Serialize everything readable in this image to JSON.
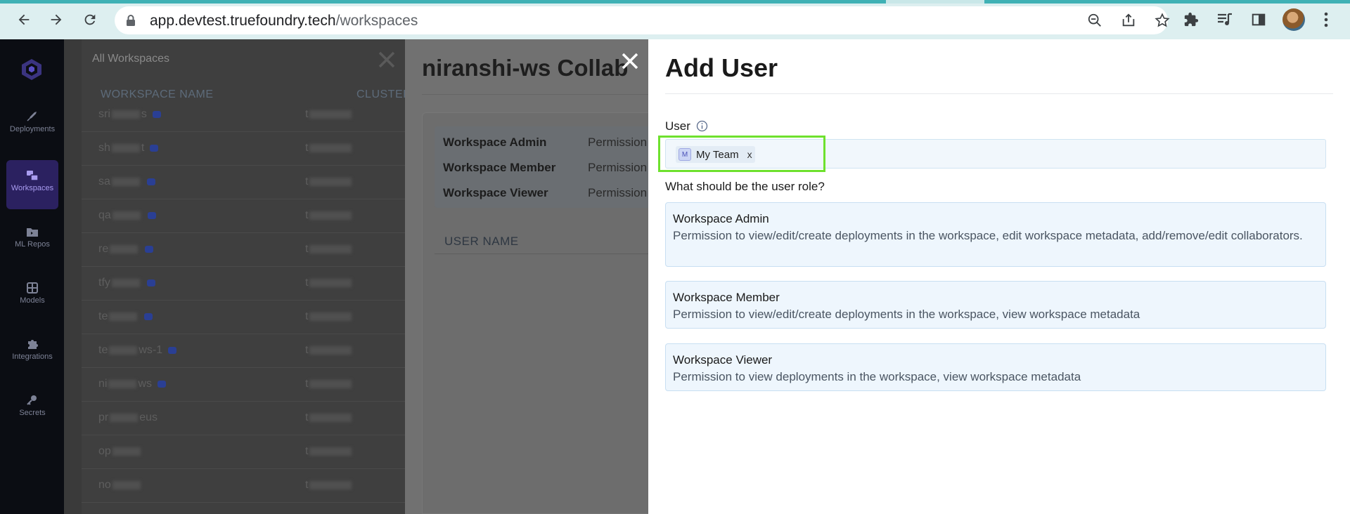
{
  "browser": {
    "url_host": "app.devtest.truefoundry.tech",
    "url_path": "/workspaces"
  },
  "sidebar": {
    "items": [
      {
        "label": "Deployments"
      },
      {
        "label": "Workspaces"
      },
      {
        "label": "ML Repos"
      },
      {
        "label": "Models"
      },
      {
        "label": "Integrations"
      },
      {
        "label": "Secrets"
      }
    ]
  },
  "workspaces_list": {
    "title": "All Workspaces",
    "col_name": "WORKSPACE NAME",
    "col_cluster": "CLUSTER",
    "rows": [
      {
        "prefix": "sri",
        "suffix": "s"
      },
      {
        "prefix": "sh",
        "suffix": "t"
      },
      {
        "prefix": "sa",
        "suffix": ""
      },
      {
        "prefix": "qa",
        "suffix": ""
      },
      {
        "prefix": "re",
        "suffix": ""
      },
      {
        "prefix": "tfy",
        "suffix": ""
      },
      {
        "prefix": "te",
        "suffix": ""
      },
      {
        "prefix": "te",
        "suffix": "ws-1"
      },
      {
        "prefix": "ni",
        "suffix": "ws"
      },
      {
        "prefix": "pr",
        "suffix": "eus"
      },
      {
        "prefix": "op",
        "suffix": ""
      },
      {
        "prefix": "no",
        "suffix": ""
      }
    ]
  },
  "collaborators": {
    "title": "niranshi-ws Collab",
    "roles": [
      {
        "name": "Workspace Admin",
        "perm": "Permission"
      },
      {
        "name": "Workspace Member",
        "perm": "Permission"
      },
      {
        "name": "Workspace Viewer",
        "perm": "Permission"
      }
    ],
    "user_name_header": "USER NAME"
  },
  "add_user": {
    "title": "Add User",
    "user_label": "User",
    "chip": {
      "avatar": "M",
      "label": "My Team",
      "remove": "x"
    },
    "role_question": "What should be the user role?",
    "roles": [
      {
        "title": "Workspace Admin",
        "desc": "Permission to view/edit/create deployments in the workspace, edit workspace metadata, add/remove/edit collaborators."
      },
      {
        "title": "Workspace Member",
        "desc": "Permission to view/edit/create deployments in the workspace, view workspace metadata"
      },
      {
        "title": "Workspace Viewer",
        "desc": "Permission to view deployments in the workspace, view workspace metadata"
      }
    ]
  },
  "colors": {
    "accent_highlight": "#6ee12e",
    "sidebar_active": "#2b2160",
    "role_card_bg": "#eef6fd"
  }
}
